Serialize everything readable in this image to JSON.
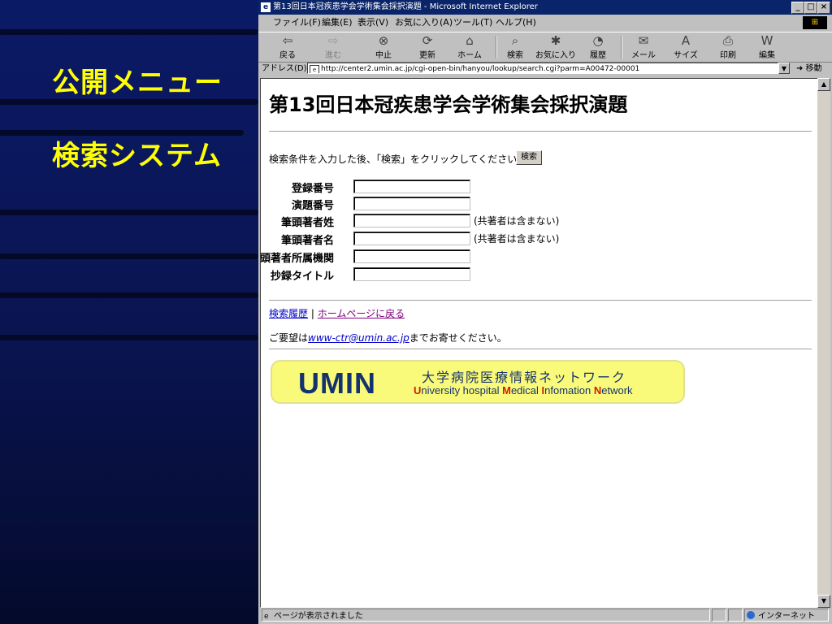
{
  "slide": {
    "title_line1": "公開メニュー",
    "title_line2": "検索システム",
    "accent_color": "#ffff00"
  },
  "window": {
    "title": "第13回日本冠疾患学会学術集会採択演題 - Microsoft Internet Explorer",
    "controls": {
      "minimize": "_",
      "maximize": "□",
      "close": "×"
    }
  },
  "menu": [
    "ファイル(F)",
    "編集(E)",
    "表示(V)",
    "お気に入り(A)",
    "ツール(T)",
    "ヘルプ(H)"
  ],
  "toolbar": [
    {
      "label": "戻る",
      "icon": "back-arrow-icon",
      "glyph": "⇦",
      "enabled": true
    },
    {
      "label": "進む",
      "icon": "forward-arrow-icon",
      "glyph": "⇨",
      "enabled": false
    },
    {
      "label": "中止",
      "icon": "stop-icon",
      "glyph": "⊗",
      "enabled": true
    },
    {
      "label": "更新",
      "icon": "refresh-icon",
      "glyph": "⟳",
      "enabled": true
    },
    {
      "label": "ホーム",
      "icon": "home-icon",
      "glyph": "⌂",
      "enabled": true
    },
    {
      "label": "検索",
      "icon": "search-icon",
      "glyph": "⌕",
      "enabled": true
    },
    {
      "label": "お気に入り",
      "icon": "favorites-icon",
      "glyph": "✱",
      "enabled": true
    },
    {
      "label": "履歴",
      "icon": "history-icon",
      "glyph": "◔",
      "enabled": true
    },
    {
      "label": "メール",
      "icon": "mail-icon",
      "glyph": "✉",
      "enabled": true
    },
    {
      "label": "サイズ",
      "icon": "font-size-icon",
      "glyph": "A",
      "enabled": true
    },
    {
      "label": "印刷",
      "icon": "print-icon",
      "glyph": "⎙",
      "enabled": true
    },
    {
      "label": "編集",
      "icon": "edit-icon",
      "glyph": "W",
      "enabled": true
    }
  ],
  "address": {
    "label": "アドレス(D)",
    "url": "http://center2.umin.ac.jp/cgi-open-bin/hanyou/lookup/search.cgi?parm=A00472-00001",
    "go_label": "移動"
  },
  "page": {
    "title": "第13回日本冠疾患学会学術集会採択演題",
    "instruction": "検索条件を入力した後、「検索」をクリックしてください。",
    "search_button": "検索",
    "fields": [
      {
        "label": "登録番号",
        "name": "registration-number-input",
        "note": ""
      },
      {
        "label": "演題番号",
        "name": "abstract-number-input",
        "note": ""
      },
      {
        "label": "筆頭著者姓",
        "name": "first-author-surname-input",
        "note": "(共著者は含まない)"
      },
      {
        "label": "筆頭著者名",
        "name": "first-author-given-name-input",
        "note": "(共著者は含まない)"
      },
      {
        "label": "筆頭著者所属機関",
        "name": "first-author-affiliation-input",
        "note": ""
      },
      {
        "label": "抄録タイトル",
        "name": "abstract-title-input",
        "note": ""
      }
    ],
    "link_history": "検索履歴",
    "link_separator": "|",
    "link_home": "ホームページに戻る",
    "contact_prefix": "ご要望は",
    "contact_email": "www-ctr@umin.ac.jp",
    "contact_suffix": "までお寄せください。"
  },
  "banner": {
    "logo": "UMIN",
    "japanese": "大学病院医療情報ネットワーク",
    "english_parts": [
      {
        "cap": "U",
        "rest": "niversity hospital "
      },
      {
        "cap": "M",
        "rest": "edical "
      },
      {
        "cap": "I",
        "rest": "nfomation "
      },
      {
        "cap": "N",
        "rest": "etwork"
      }
    ]
  },
  "status": {
    "text": "ページが表示されました",
    "zone": "インターネット"
  }
}
